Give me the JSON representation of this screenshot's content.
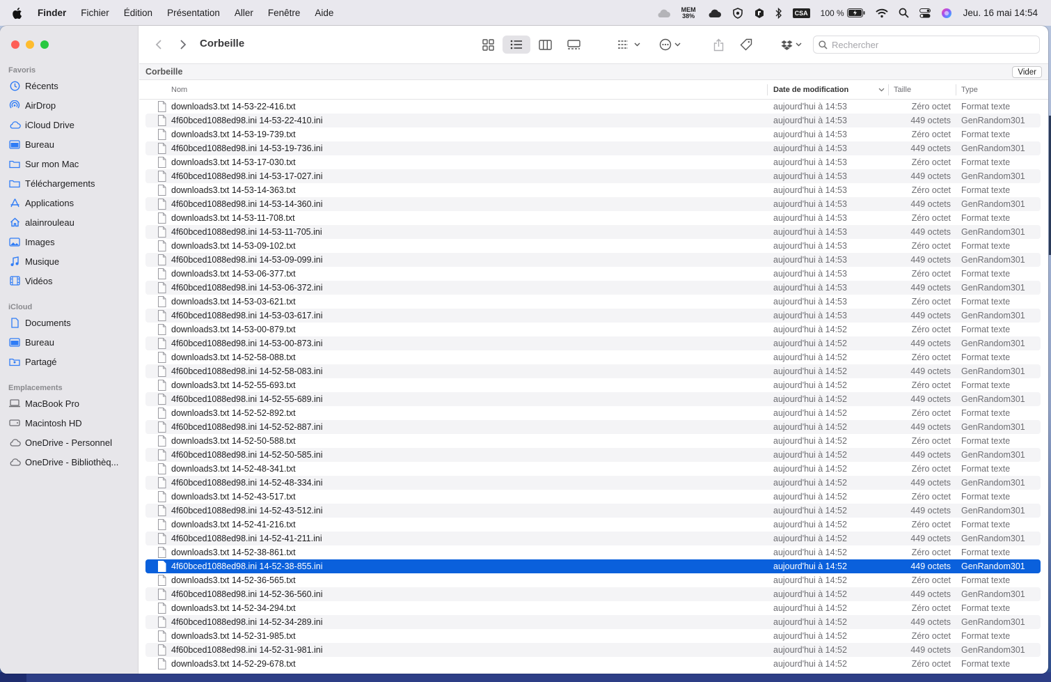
{
  "menubar": {
    "app": "Finder",
    "items": [
      "Fichier",
      "Édition",
      "Présentation",
      "Aller",
      "Fenêtre",
      "Aide"
    ],
    "status": {
      "mem_label": "MEM",
      "mem_value": "38%",
      "csa": "CSA",
      "battery": "100 %",
      "clock": "Jeu. 16 mai 14:54"
    }
  },
  "sidebar": {
    "favorites_title": "Favoris",
    "favorites": [
      {
        "label": "Récents",
        "icon": "clock-icon"
      },
      {
        "label": "AirDrop",
        "icon": "airdrop-icon"
      },
      {
        "label": "iCloud Drive",
        "icon": "cloud-icon"
      },
      {
        "label": "Bureau",
        "icon": "desktop-icon"
      },
      {
        "label": "Sur mon Mac",
        "icon": "folder-icon"
      },
      {
        "label": "Téléchargements",
        "icon": "folder-icon"
      },
      {
        "label": "Applications",
        "icon": "applications-icon"
      },
      {
        "label": "alainrouleau",
        "icon": "home-icon"
      },
      {
        "label": "Images",
        "icon": "photos-icon"
      },
      {
        "label": "Musique",
        "icon": "music-icon"
      },
      {
        "label": "Vidéos",
        "icon": "film-icon"
      }
    ],
    "icloud_title": "iCloud",
    "icloud": [
      {
        "label": "Documents",
        "icon": "document-icon"
      },
      {
        "label": "Bureau",
        "icon": "desktop-icon"
      },
      {
        "label": "Partagé",
        "icon": "shared-folder-icon"
      }
    ],
    "locations_title": "Emplacements",
    "locations": [
      {
        "label": "MacBook Pro",
        "icon": "laptop-icon"
      },
      {
        "label": "Macintosh HD",
        "icon": "disk-icon"
      },
      {
        "label": "OneDrive - Personnel",
        "icon": "cloud-icon"
      },
      {
        "label": "OneDrive - Bibliothèq...",
        "icon": "cloud-icon"
      }
    ]
  },
  "toolbar": {
    "title": "Corbeille",
    "search_placeholder": "Rechercher"
  },
  "pathbar": {
    "title": "Corbeille",
    "empty_label": "Vider"
  },
  "columns": {
    "name": "Nom",
    "date": "Date de modification",
    "size": "Taille",
    "type": "Type"
  },
  "files": [
    {
      "name": "downloads3.txt 14-53-22-416.txt",
      "date": "aujourd'hui à 14:53",
      "size": "Zéro octet",
      "type": "Format texte"
    },
    {
      "name": "4f60bced1088ed98.ini 14-53-22-410.ini",
      "date": "aujourd'hui à 14:53",
      "size": "449 octets",
      "type": "GenRandom301"
    },
    {
      "name": "downloads3.txt 14-53-19-739.txt",
      "date": "aujourd'hui à 14:53",
      "size": "Zéro octet",
      "type": "Format texte"
    },
    {
      "name": "4f60bced1088ed98.ini 14-53-19-736.ini",
      "date": "aujourd'hui à 14:53",
      "size": "449 octets",
      "type": "GenRandom301"
    },
    {
      "name": "downloads3.txt 14-53-17-030.txt",
      "date": "aujourd'hui à 14:53",
      "size": "Zéro octet",
      "type": "Format texte"
    },
    {
      "name": "4f60bced1088ed98.ini 14-53-17-027.ini",
      "date": "aujourd'hui à 14:53",
      "size": "449 octets",
      "type": "GenRandom301"
    },
    {
      "name": "downloads3.txt 14-53-14-363.txt",
      "date": "aujourd'hui à 14:53",
      "size": "Zéro octet",
      "type": "Format texte"
    },
    {
      "name": "4f60bced1088ed98.ini 14-53-14-360.ini",
      "date": "aujourd'hui à 14:53",
      "size": "449 octets",
      "type": "GenRandom301"
    },
    {
      "name": "downloads3.txt 14-53-11-708.txt",
      "date": "aujourd'hui à 14:53",
      "size": "Zéro octet",
      "type": "Format texte"
    },
    {
      "name": "4f60bced1088ed98.ini 14-53-11-705.ini",
      "date": "aujourd'hui à 14:53",
      "size": "449 octets",
      "type": "GenRandom301"
    },
    {
      "name": "downloads3.txt 14-53-09-102.txt",
      "date": "aujourd'hui à 14:53",
      "size": "Zéro octet",
      "type": "Format texte"
    },
    {
      "name": "4f60bced1088ed98.ini 14-53-09-099.ini",
      "date": "aujourd'hui à 14:53",
      "size": "449 octets",
      "type": "GenRandom301"
    },
    {
      "name": "downloads3.txt 14-53-06-377.txt",
      "date": "aujourd'hui à 14:53",
      "size": "Zéro octet",
      "type": "Format texte"
    },
    {
      "name": "4f60bced1088ed98.ini 14-53-06-372.ini",
      "date": "aujourd'hui à 14:53",
      "size": "449 octets",
      "type": "GenRandom301"
    },
    {
      "name": "downloads3.txt 14-53-03-621.txt",
      "date": "aujourd'hui à 14:53",
      "size": "Zéro octet",
      "type": "Format texte"
    },
    {
      "name": "4f60bced1088ed98.ini 14-53-03-617.ini",
      "date": "aujourd'hui à 14:53",
      "size": "449 octets",
      "type": "GenRandom301"
    },
    {
      "name": "downloads3.txt 14-53-00-879.txt",
      "date": "aujourd'hui à 14:52",
      "size": "Zéro octet",
      "type": "Format texte"
    },
    {
      "name": "4f60bced1088ed98.ini 14-53-00-873.ini",
      "date": "aujourd'hui à 14:52",
      "size": "449 octets",
      "type": "GenRandom301"
    },
    {
      "name": "downloads3.txt 14-52-58-088.txt",
      "date": "aujourd'hui à 14:52",
      "size": "Zéro octet",
      "type": "Format texte"
    },
    {
      "name": "4f60bced1088ed98.ini 14-52-58-083.ini",
      "date": "aujourd'hui à 14:52",
      "size": "449 octets",
      "type": "GenRandom301"
    },
    {
      "name": "downloads3.txt 14-52-55-693.txt",
      "date": "aujourd'hui à 14:52",
      "size": "Zéro octet",
      "type": "Format texte"
    },
    {
      "name": "4f60bced1088ed98.ini 14-52-55-689.ini",
      "date": "aujourd'hui à 14:52",
      "size": "449 octets",
      "type": "GenRandom301"
    },
    {
      "name": "downloads3.txt 14-52-52-892.txt",
      "date": "aujourd'hui à 14:52",
      "size": "Zéro octet",
      "type": "Format texte"
    },
    {
      "name": "4f60bced1088ed98.ini 14-52-52-887.ini",
      "date": "aujourd'hui à 14:52",
      "size": "449 octets",
      "type": "GenRandom301"
    },
    {
      "name": "downloads3.txt 14-52-50-588.txt",
      "date": "aujourd'hui à 14:52",
      "size": "Zéro octet",
      "type": "Format texte"
    },
    {
      "name": "4f60bced1088ed98.ini 14-52-50-585.ini",
      "date": "aujourd'hui à 14:52",
      "size": "449 octets",
      "type": "GenRandom301"
    },
    {
      "name": "downloads3.txt 14-52-48-341.txt",
      "date": "aujourd'hui à 14:52",
      "size": "Zéro octet",
      "type": "Format texte"
    },
    {
      "name": "4f60bced1088ed98.ini 14-52-48-334.ini",
      "date": "aujourd'hui à 14:52",
      "size": "449 octets",
      "type": "GenRandom301"
    },
    {
      "name": "downloads3.txt 14-52-43-517.txt",
      "date": "aujourd'hui à 14:52",
      "size": "Zéro octet",
      "type": "Format texte"
    },
    {
      "name": "4f60bced1088ed98.ini 14-52-43-512.ini",
      "date": "aujourd'hui à 14:52",
      "size": "449 octets",
      "type": "GenRandom301"
    },
    {
      "name": "downloads3.txt 14-52-41-216.txt",
      "date": "aujourd'hui à 14:52",
      "size": "Zéro octet",
      "type": "Format texte"
    },
    {
      "name": "4f60bced1088ed98.ini 14-52-41-211.ini",
      "date": "aujourd'hui à 14:52",
      "size": "449 octets",
      "type": "GenRandom301"
    },
    {
      "name": "downloads3.txt 14-52-38-861.txt",
      "date": "aujourd'hui à 14:52",
      "size": "Zéro octet",
      "type": "Format texte"
    },
    {
      "name": "4f60bced1088ed98.ini 14-52-38-855.ini",
      "date": "aujourd'hui à 14:52",
      "size": "449 octets",
      "type": "GenRandom301",
      "selected": true
    },
    {
      "name": "downloads3.txt 14-52-36-565.txt",
      "date": "aujourd'hui à 14:52",
      "size": "Zéro octet",
      "type": "Format texte"
    },
    {
      "name": "4f60bced1088ed98.ini 14-52-36-560.ini",
      "date": "aujourd'hui à 14:52",
      "size": "449 octets",
      "type": "GenRandom301"
    },
    {
      "name": "downloads3.txt 14-52-34-294.txt",
      "date": "aujourd'hui à 14:52",
      "size": "Zéro octet",
      "type": "Format texte"
    },
    {
      "name": "4f60bced1088ed98.ini 14-52-34-289.ini",
      "date": "aujourd'hui à 14:52",
      "size": "449 octets",
      "type": "GenRandom301"
    },
    {
      "name": "downloads3.txt 14-52-31-985.txt",
      "date": "aujourd'hui à 14:52",
      "size": "Zéro octet",
      "type": "Format texte"
    },
    {
      "name": "4f60bced1088ed98.ini 14-52-31-981.ini",
      "date": "aujourd'hui à 14:52",
      "size": "449 octets",
      "type": "GenRandom301"
    },
    {
      "name": "downloads3.txt 14-52-29-678.txt",
      "date": "aujourd'hui à 14:52",
      "size": "Zéro octet",
      "type": "Format texte"
    }
  ],
  "colors": {
    "accent": "#0a60dc",
    "close": "#fe5f57",
    "minimize": "#febc2e",
    "zoom": "#28c840"
  }
}
